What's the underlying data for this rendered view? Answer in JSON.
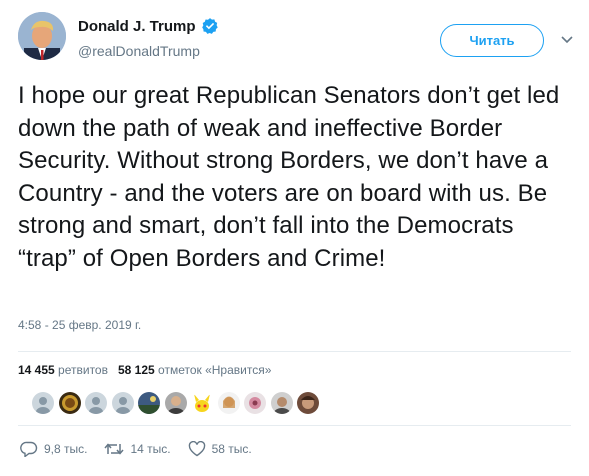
{
  "user": {
    "display_name": "Donald J. Trump",
    "handle": "@realDonaldTrump",
    "verified": true
  },
  "follow_button": {
    "label": "Читать",
    "color": "#1da1f2"
  },
  "tweet": {
    "text": "I hope our great Republican Senators don’t get led down the path of weak and ineffective Border Security. Without strong Borders, we don’t have a Country - and the voters are on board with us. Be strong and smart, don’t fall into the Democrats “trap” of Open Borders and Crime!",
    "timestamp": "4:58 - 25 февр. 2019 г."
  },
  "stats": {
    "retweets_count": "14 455",
    "retweets_label": "ретвитов",
    "likes_count": "58 125",
    "likes_label": "отметок «Нравится»"
  },
  "likers": [
    {
      "icon": "default-avatar"
    },
    {
      "icon": "seal-avatar"
    },
    {
      "icon": "default-avatar"
    },
    {
      "icon": "default-avatar"
    },
    {
      "icon": "landscape-avatar"
    },
    {
      "icon": "portrait-avatar"
    },
    {
      "icon": "pikachu-avatar"
    },
    {
      "icon": "portrait-avatar"
    },
    {
      "icon": "flower-avatar"
    },
    {
      "icon": "portrait-avatar"
    },
    {
      "icon": "portrait-avatar"
    }
  ],
  "actions": {
    "replies": "9,8 тыс.",
    "retweets": "14 тыс.",
    "likes": "58 тыс."
  },
  "colors": {
    "accent": "#1da1f2",
    "muted": "#657786",
    "text": "#14171a"
  }
}
